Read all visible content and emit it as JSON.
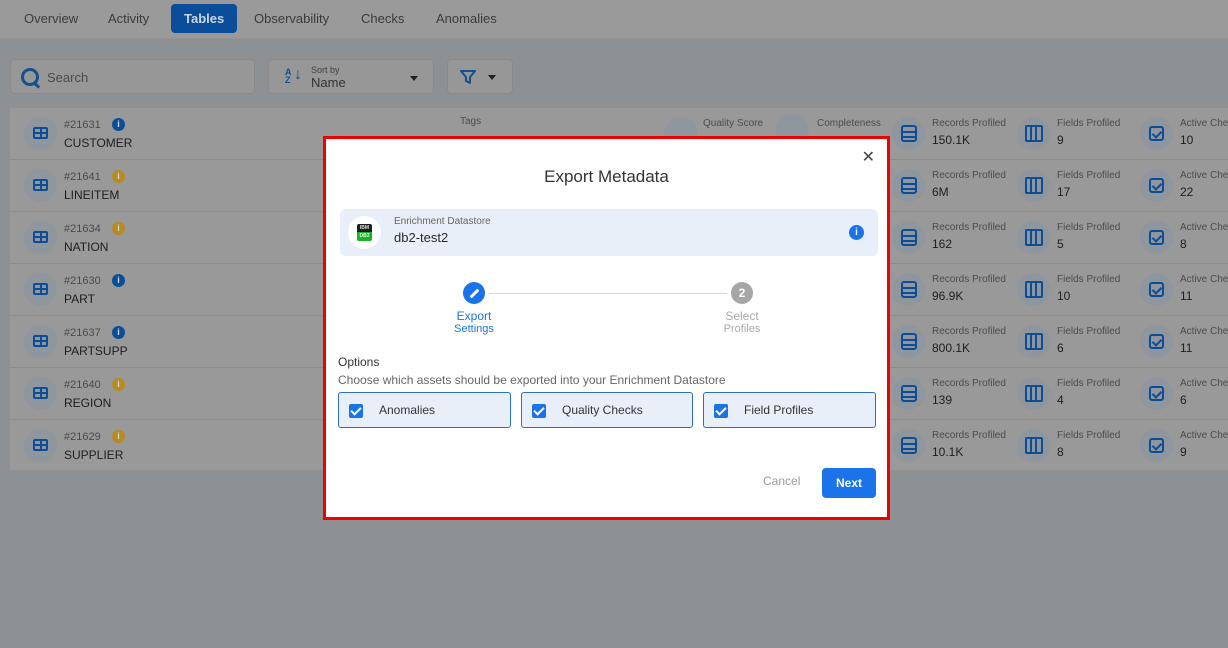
{
  "tabs": [
    {
      "label": "Overview",
      "active": false
    },
    {
      "label": "Activity",
      "active": false
    },
    {
      "label": "Tables",
      "active": true
    },
    {
      "label": "Observability",
      "active": false
    },
    {
      "label": "Checks",
      "active": false
    },
    {
      "label": "Anomalies",
      "active": false
    }
  ],
  "toolbar": {
    "search_placeholder": "Search",
    "sort_label": "Sort by",
    "sort_value": "Name",
    "sort_icon": "sort-az-icon",
    "filter_icon": "filter-icon"
  },
  "table_headers": {
    "tags": "Tags",
    "quality_score": "Quality Score",
    "completeness": "Completeness",
    "records_profiled": "Records Profiled",
    "fields_profiled": "Fields Profiled",
    "active_checks": "Active Che"
  },
  "rows": [
    {
      "id": "#21631",
      "name": "CUSTOMER",
      "info_color": "#0d4d95",
      "records": "150.1K",
      "fields": "9",
      "checks": "10"
    },
    {
      "id": "#21641",
      "name": "LINEITEM",
      "info_color": "#b98a1e",
      "records": "6M",
      "fields": "17",
      "checks": "22"
    },
    {
      "id": "#21634",
      "name": "NATION",
      "info_color": "#b98a1e",
      "records": "162",
      "fields": "5",
      "checks": "8"
    },
    {
      "id": "#21630",
      "name": "PART",
      "info_color": "#0d4d95",
      "records": "96.9K",
      "fields": "10",
      "checks": "11"
    },
    {
      "id": "#21637",
      "name": "PARTSUPP",
      "info_color": "#0d4d95",
      "records": "800.1K",
      "fields": "6",
      "checks": "11"
    },
    {
      "id": "#21640",
      "name": "REGION",
      "info_color": "#b98a1e",
      "records": "139",
      "fields": "4",
      "checks": "6"
    },
    {
      "id": "#21629",
      "name": "SUPPLIER",
      "info_color": "#b98a1e",
      "records": "10.1K",
      "fields": "8",
      "checks": "9"
    }
  ],
  "modal": {
    "title": "Export Metadata",
    "close_icon": "close-icon",
    "datastore": {
      "label": "Enrichment Datastore",
      "name": "db2-test2",
      "logo_top": "IBM",
      "logo_bottom": "DB2"
    },
    "steps": [
      {
        "number": "1",
        "line1": "Export",
        "line2": "Settings",
        "state": "active"
      },
      {
        "number": "2",
        "line1": "Select",
        "line2": "Profiles",
        "state": "pending"
      }
    ],
    "options_title": "Options",
    "options_description": "Choose which assets should be exported into your Enrichment Datastore",
    "options": [
      {
        "label": "Anomalies",
        "checked": true
      },
      {
        "label": "Quality Checks",
        "checked": true
      },
      {
        "label": "Field Profiles",
        "checked": true
      }
    ],
    "cancel_label": "Cancel",
    "next_label": "Next"
  },
  "colors": {
    "accent": "#1a73e8",
    "highlight_border": "#ee0000",
    "overlay": "#8e9193"
  }
}
